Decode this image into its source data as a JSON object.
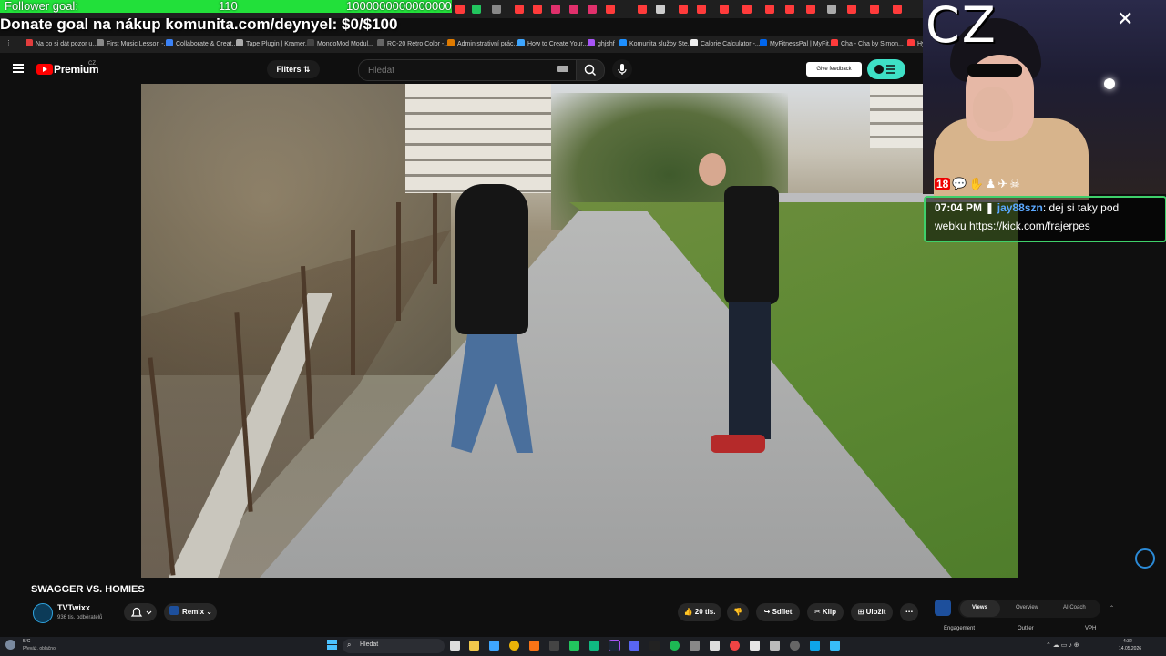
{
  "overlay": {
    "follower_label": "Follower goal:",
    "follower_current": "110",
    "follower_target": "1000000000000000",
    "donate_text": "Donate goal na nákup komunita.com/deynyel: $0/$100",
    "cz_text": "CZ"
  },
  "bookmarks": [
    {
      "label": "Na co si dát pozor u...",
      "color": "#e23d3d"
    },
    {
      "label": "First Music Lesson -...",
      "color": "#888888"
    },
    {
      "label": "Collaborate & Creat...",
      "color": "#3b82f6"
    },
    {
      "label": "Tape Plugin | Kramer...",
      "color": "#aaaaaa"
    },
    {
      "label": "MondoMod Modul...",
      "color": "#444444"
    },
    {
      "label": "RC-20 Retro Color -...",
      "color": "#666666"
    },
    {
      "label": "Administrativní prác...",
      "color": "#e07b00"
    },
    {
      "label": "How to Create Your...",
      "color": "#3ea6ff"
    },
    {
      "label": "ghjshf",
      "color": "#a855f7"
    },
    {
      "label": "Komunita služby Ste...",
      "color": "#1e90ff"
    },
    {
      "label": "Calorie Calculator -...",
      "color": "#eeeeee"
    },
    {
      "label": "MyFitnessPal | MyFit...",
      "color": "#0066ee"
    },
    {
      "label": "Cha - Cha by Simon...",
      "color": "#ff3b3b"
    },
    {
      "label": "Hype",
      "color": "#ff3b3b"
    }
  ],
  "youtube": {
    "brand": "Premium",
    "region": "CZ",
    "filters_label": "Filters",
    "search_placeholder": "Hledat",
    "feedback_label": "Give feedback"
  },
  "video": {
    "title": "SWAGGER VS. HOMIES",
    "channel_name": "TVTwixx",
    "channel_subs": "936 tis. odběratelů",
    "remix_label": "Remix",
    "like_count": "20 tis.",
    "share_label": "Sdílet",
    "clip_label": "Klip",
    "save_label": "Uložit"
  },
  "side_panel": {
    "tabs": [
      "Views",
      "Overview",
      "AI Coach"
    ],
    "active_tab": "Views",
    "columns": [
      "Engagement",
      "Outlier",
      "VPH"
    ]
  },
  "chat": {
    "time": "07:04 PM",
    "username": "jay88szn",
    "message_part1": ": dej si taky pod",
    "message_part2": "webku ",
    "link": "https://kick.com/frajerpes"
  },
  "taskbar": {
    "weather_temp": "5°C",
    "weather_text": "Převáž. oblačno",
    "search_label": "Hledat",
    "time": "4:32",
    "date": "14.05.2026"
  },
  "colors": {
    "follower_bar": "#22e03a",
    "youtube_red": "#ff0000",
    "chat_border": "#3fd06a",
    "chat_username": "#5aa8ff",
    "accent_teal": "#3ee0c6"
  }
}
